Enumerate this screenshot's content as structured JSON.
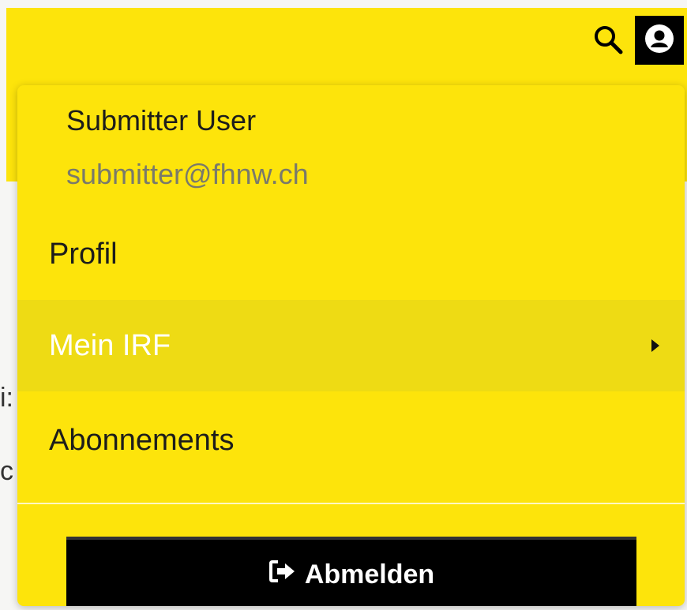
{
  "colors": {
    "brand_yellow": "#fde40b",
    "active_item": "#eedb14",
    "black": "#000000"
  },
  "header": {
    "search_icon": "search-icon",
    "user_icon": "user-circle-icon"
  },
  "background": {
    "fragments": [
      "i:",
      "c"
    ]
  },
  "dropdown": {
    "user_name": "Submitter User",
    "user_email": "submitter@fhnw.ch",
    "items": [
      {
        "label": "Profil"
      },
      {
        "label": "Mein IRF",
        "has_submenu": true,
        "active": true
      },
      {
        "label": "Abonnements"
      }
    ],
    "logout": {
      "label": "Abmelden",
      "icon": "sign-out-icon"
    }
  }
}
